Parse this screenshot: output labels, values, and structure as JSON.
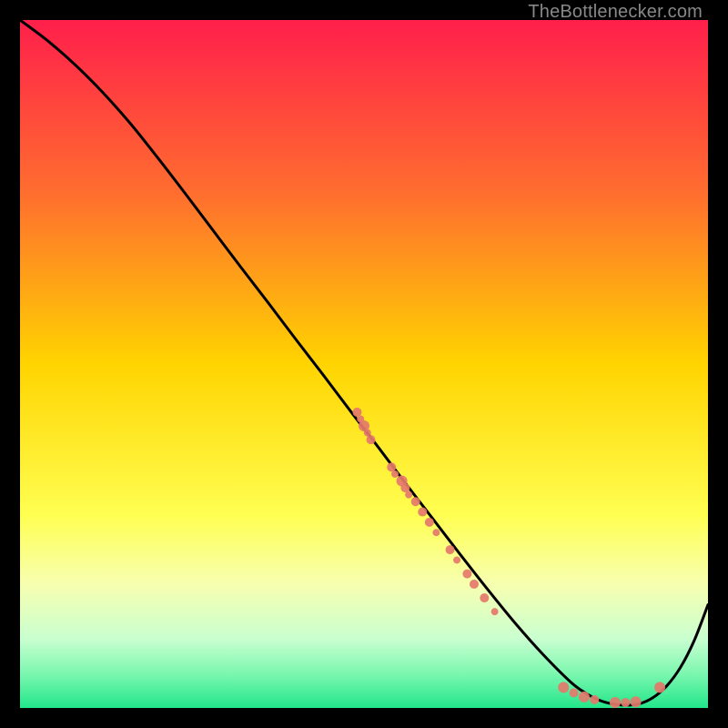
{
  "attribution": "TheBottlenecker.com",
  "chart_data": {
    "type": "line",
    "title": "",
    "xlabel": "",
    "ylabel": "",
    "xlim": [
      0,
      100
    ],
    "ylim": [
      0,
      100
    ],
    "gradient_stops": [
      {
        "offset": 0.0,
        "color": "#ff1f4b"
      },
      {
        "offset": 0.25,
        "color": "#ff6d2f"
      },
      {
        "offset": 0.5,
        "color": "#ffd400"
      },
      {
        "offset": 0.72,
        "color": "#ffff52"
      },
      {
        "offset": 0.82,
        "color": "#f7ffb0"
      },
      {
        "offset": 0.9,
        "color": "#c9ffd0"
      },
      {
        "offset": 0.95,
        "color": "#7cf7b0"
      },
      {
        "offset": 1.0,
        "color": "#22e68a"
      }
    ],
    "series": [
      {
        "name": "bottleneck-curve",
        "x": [
          0,
          4,
          8,
          12,
          16,
          20,
          24,
          28,
          32,
          36,
          40,
          44,
          48,
          52,
          56,
          60,
          64,
          68,
          72,
          76,
          80,
          82,
          84,
          86,
          88,
          90,
          92,
          94,
          96,
          98,
          100
        ],
        "y": [
          100,
          97,
          93.5,
          89.5,
          85,
          80,
          74.8,
          69.5,
          64.2,
          59,
          53.7,
          48.5,
          43.2,
          38,
          32.7,
          27.5,
          22.3,
          17.2,
          12.3,
          7.8,
          3.8,
          2.3,
          1.2,
          0.6,
          0.4,
          0.6,
          1.5,
          3.2,
          5.9,
          9.8,
          15
        ]
      }
    ],
    "scatter_points": {
      "name": "data-points",
      "color": "#e5786b",
      "points": [
        {
          "x": 49.0,
          "y": 43.0,
          "r": 5
        },
        {
          "x": 49.5,
          "y": 42.0,
          "r": 4
        },
        {
          "x": 50.0,
          "y": 41.0,
          "r": 6
        },
        {
          "x": 50.5,
          "y": 40.0,
          "r": 4
        },
        {
          "x": 51.0,
          "y": 39.0,
          "r": 5
        },
        {
          "x": 54.0,
          "y": 35.0,
          "r": 5
        },
        {
          "x": 54.5,
          "y": 34.0,
          "r": 4
        },
        {
          "x": 55.5,
          "y": 33.0,
          "r": 6
        },
        {
          "x": 56.0,
          "y": 32.0,
          "r": 5
        },
        {
          "x": 56.5,
          "y": 31.0,
          "r": 4
        },
        {
          "x": 57.5,
          "y": 30.0,
          "r": 5
        },
        {
          "x": 58.5,
          "y": 28.5,
          "r": 5
        },
        {
          "x": 59.5,
          "y": 27.0,
          "r": 5
        },
        {
          "x": 60.5,
          "y": 25.5,
          "r": 4
        },
        {
          "x": 62.5,
          "y": 23.0,
          "r": 5
        },
        {
          "x": 63.5,
          "y": 21.5,
          "r": 4
        },
        {
          "x": 65.0,
          "y": 19.5,
          "r": 5
        },
        {
          "x": 66.0,
          "y": 18.0,
          "r": 5
        },
        {
          "x": 67.5,
          "y": 16.0,
          "r": 5
        },
        {
          "x": 69.0,
          "y": 14.0,
          "r": 4
        },
        {
          "x": 79.0,
          "y": 3.0,
          "r": 6
        },
        {
          "x": 80.5,
          "y": 2.2,
          "r": 5
        },
        {
          "x": 82.0,
          "y": 1.6,
          "r": 6
        },
        {
          "x": 83.5,
          "y": 1.2,
          "r": 5
        },
        {
          "x": 86.5,
          "y": 0.8,
          "r": 6
        },
        {
          "x": 88.0,
          "y": 0.8,
          "r": 5
        },
        {
          "x": 89.5,
          "y": 0.9,
          "r": 6
        },
        {
          "x": 93.0,
          "y": 3.0,
          "r": 6
        }
      ]
    }
  }
}
